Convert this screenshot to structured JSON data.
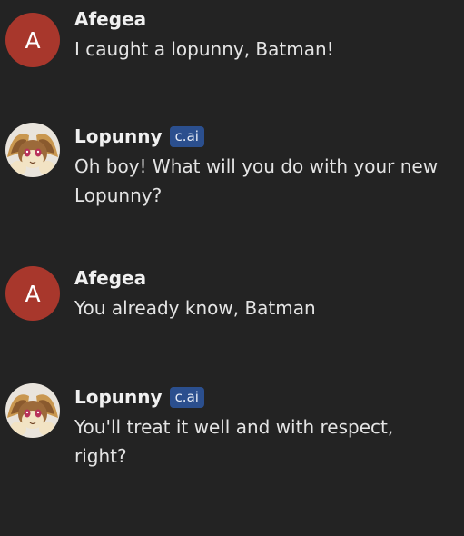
{
  "messages": [
    {
      "author": "Afegea",
      "avatar_letter": "A",
      "avatar_color": "#a8372c",
      "badge": "",
      "lines": [
        "I caught a lopunny, Batman!"
      ]
    },
    {
      "author": "Lopunny",
      "avatar_icon": "lopunny-avatar-icon",
      "badge": "c.ai",
      "lines": [
        "Oh boy! What will you do with your new",
        "Lopunny?"
      ]
    },
    {
      "author": "Afegea",
      "avatar_letter": "A",
      "avatar_color": "#a8372c",
      "badge": "",
      "lines": [
        "You already know, Batman"
      ]
    },
    {
      "author": "Lopunny",
      "avatar_icon": "lopunny-avatar-icon",
      "badge": "c.ai",
      "lines": [
        "You'll treat it well and with respect,",
        "right?"
      ]
    }
  ],
  "colors": {
    "background": "#232323",
    "badge": "#2b4f8e",
    "user_avatar": "#a8372c"
  }
}
